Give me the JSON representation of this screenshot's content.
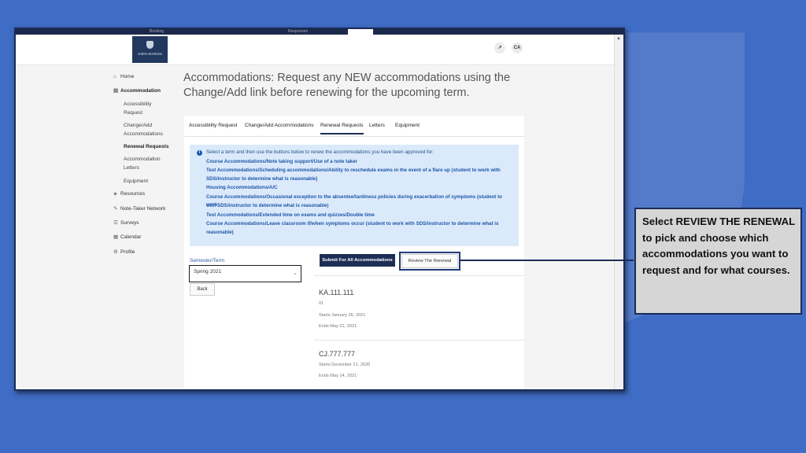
{
  "app": {
    "tab_partial_left": "Booking",
    "tab_partial_right": "Responses",
    "logo_text": "JOHNS HOPKINS",
    "header_buttons": [
      "↗",
      "CA"
    ]
  },
  "sidebar": {
    "items": [
      {
        "icon": "home-icon",
        "glyph": "⌂",
        "label": "Home"
      },
      {
        "icon": "accommodation-icon",
        "glyph": "▤",
        "label": "Accommodation"
      },
      {
        "icon": "resources-icon",
        "glyph": "◈",
        "label": "Resources"
      },
      {
        "icon": "notetaker-icon",
        "glyph": "✎",
        "label": "Note-Taker Network"
      },
      {
        "icon": "surveys-icon",
        "glyph": "☰",
        "label": "Surveys"
      },
      {
        "icon": "calendar-icon",
        "glyph": "▦",
        "label": "Calendar"
      },
      {
        "icon": "profile-icon",
        "glyph": "⚙",
        "label": "Profile"
      }
    ],
    "subitems": [
      {
        "label1": "Accessibility",
        "label2": "Request"
      },
      {
        "label1": "Change/Add",
        "label2": "Accommodations"
      },
      {
        "label1": "Renewal Requests",
        "label2": ""
      },
      {
        "label1": "Accommodation",
        "label2": "Letters"
      },
      {
        "label1": "Equipment",
        "label2": ""
      }
    ]
  },
  "main": {
    "title_line1": "Accommodations: Request any NEW accommodations using the",
    "title_line2": "Change/Add link before renewing for the upcoming term.",
    "tabs": [
      "Accessibility Request",
      "Change/Add Accommodations",
      "Renewal Requests",
      "Letters",
      "Equipment"
    ],
    "active_tab": "Renewal Requests",
    "info_intro": "Select a term and then use the buttons below to renew the accommodations you have been approved for:",
    "info_items": [
      "Course Accommodations/Note taking support/Use of a note taker",
      "Test Accommodations/Scheduling accommodations/Ability to reschedule exams in the event of a flare up (student to work with",
      "SDS/instructor to determine what is reasonable)",
      "Housing Accommodations/A/C",
      "Course Accommodations/Occasional exception to the absentee/tardiness policies during exacerbation of symptoms (student to work",
      "with SDS/instructor to determine what is reasonable)",
      "Test Accommodations/Extended time on exams and quizzes/Double time",
      "Course Accommodations/Leave classroom if/when symptoms occur (student to work with SDS/instructor to determine what is",
      "reasonable)"
    ],
    "semester_label": "Semester/Term",
    "semester_value": "Spring 2021",
    "back_label": "Back",
    "submit_label": "Submit For All Accommodations",
    "review_label": "Review The Renewal",
    "courses": [
      {
        "code": "KA.111.111",
        "section": "01",
        "starts": "Starts January 26, 2021",
        "ends": "Ends May 21, 2021"
      },
      {
        "code": "CJ.777.777",
        "section": "",
        "starts": "Starts December 21, 2020",
        "ends": "Ends May 14, 2021"
      }
    ]
  },
  "callout": {
    "text": "Select REVIEW THE RENEWAL to pick and choose which accommodations you want to request and for what courses."
  },
  "colors": {
    "background": "#3f6cc4",
    "navy": "#1c2e55",
    "info_bg": "#dbeafb",
    "info_text": "#1d56a7",
    "callout_bg": "#d6d6d6"
  }
}
